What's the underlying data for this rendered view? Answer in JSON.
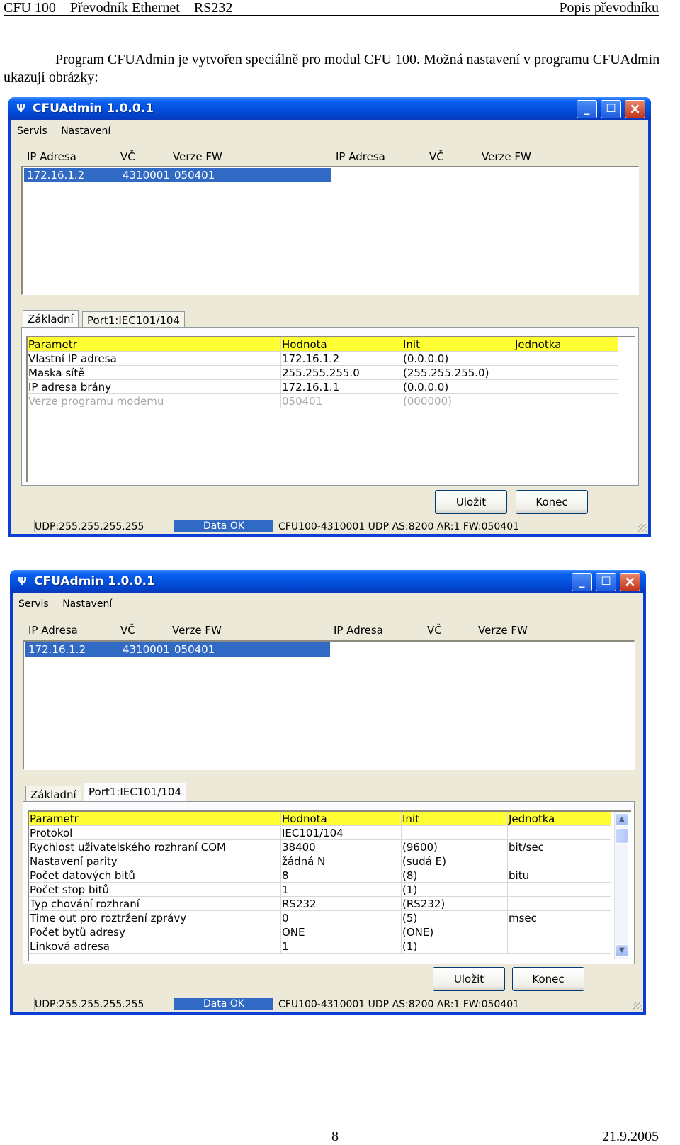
{
  "header": {
    "left": "CFU 100 – Převodník Ethernet – RS232",
    "right": "Popis převodníku"
  },
  "intro": "Program CFUAdmin je vytvořen speciálně pro modul CFU 100. Možná nastavení v programu CFUAdmin ukazují obrázky:",
  "footer": {
    "page": "8",
    "date": "21.9.2005"
  },
  "window": {
    "title": "CFUAdmin 1.0.0.1",
    "menu": [
      "Servis",
      "Nastavení"
    ],
    "device_columns": [
      "IP Adresa",
      "VČ",
      "Verze FW",
      "IP Adresa",
      "VČ",
      "Verze FW"
    ],
    "device": {
      "ip": "172.16.1.2",
      "vc": "4310001",
      "fw": "050401"
    },
    "tabs": [
      "Základní",
      "Port1:IEC101/104"
    ],
    "grid_header": [
      "Parametr",
      "Hodnota",
      "Init",
      "Jednotka"
    ],
    "buttons": {
      "save": "Uložit",
      "close": "Konec"
    },
    "status": {
      "udp": "UDP:255.255.255.255",
      "data": "Data OK",
      "info": "CFU100-4310001 UDP AS:8200 AR:1 FW:050401"
    }
  },
  "basic_rows": [
    {
      "p": "Vlastní IP adresa",
      "v": "172.16.1.2",
      "i": "(0.0.0.0)",
      "u": ""
    },
    {
      "p": "Maska sítě",
      "v": "255.255.255.0",
      "i": "(255.255.255.0)",
      "u": ""
    },
    {
      "p": "IP adresa brány",
      "v": "172.16.1.1",
      "i": "(0.0.0.0)",
      "u": ""
    },
    {
      "p": "Verze programu modemu",
      "v": "050401",
      "i": "(000000)",
      "u": ""
    }
  ],
  "port_rows": [
    {
      "p": "Protokol",
      "v": "IEC101/104",
      "i": "",
      "u": ""
    },
    {
      "p": "Rychlost uživatelského rozhraní COM",
      "v": "38400",
      "i": "(9600)",
      "u": "bit/sec"
    },
    {
      "p": "Nastavení parity",
      "v": "žádná N",
      "i": "(sudá E)",
      "u": ""
    },
    {
      "p": "Počet datových bitů",
      "v": "8",
      "i": "(8)",
      "u": "bitu"
    },
    {
      "p": "Počet stop bitů",
      "v": "1",
      "i": "(1)",
      "u": ""
    },
    {
      "p": "Typ chování rozhraní",
      "v": "RS232",
      "i": "(RS232)",
      "u": ""
    },
    {
      "p": "Time out pro roztržení zprávy",
      "v": "0",
      "i": "(5)",
      "u": "msec"
    },
    {
      "p": "Počet bytů adresy",
      "v": "ONE",
      "i": "(ONE)",
      "u": ""
    },
    {
      "p": "Linková adresa",
      "v": "1",
      "i": "(1)",
      "u": ""
    }
  ]
}
